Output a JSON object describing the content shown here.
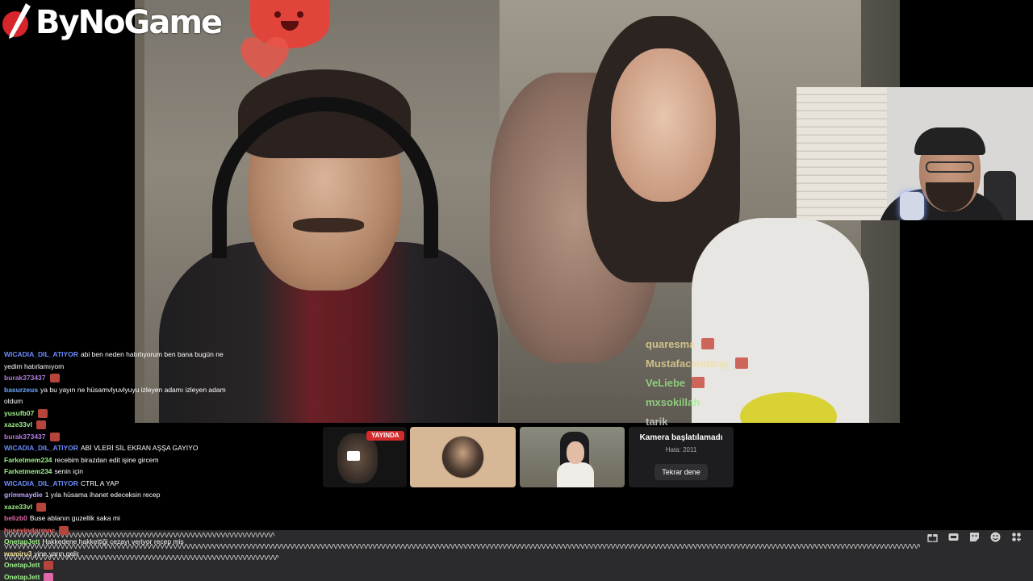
{
  "brand": {
    "logo_text": "ByNoGame"
  },
  "overlay_chat": [
    {
      "user": "quaresma",
      "color": "#f0e09a"
    },
    {
      "user": "Mustafacandang",
      "color": "#f0e09a"
    },
    {
      "user": "VeLiebe",
      "color": "#9ef08a"
    },
    {
      "user": "mxsokillah",
      "color": "#9ef08a"
    },
    {
      "user": "tarik",
      "color": "#dddddd"
    }
  ],
  "chat": [
    {
      "user": "WICADIA_DIL_ATIYOR",
      "color": "#6b8cff",
      "text": "abi ben neden hatırlıyorum ben bana bugün ne"
    },
    {
      "user": "",
      "color": "#ffffff",
      "text": "yedim hatırlamıyom"
    },
    {
      "user": "burak373437",
      "color": "#b07ae0",
      "text": "",
      "emote": true
    },
    {
      "user": "basurzeus",
      "color": "#6fa8ff",
      "text": "ya bu yayın ne hüsamvlyuvlyuyu izleyen adamı izleyen adam oldum"
    },
    {
      "user": "yusufb07",
      "color": "#9ef08a",
      "text": "",
      "emote": true
    },
    {
      "user": "xaze33vl",
      "color": "#9ef08a",
      "text": "",
      "emote": true
    },
    {
      "user": "burak373437",
      "color": "#b07ae0",
      "text": "",
      "emote": true
    },
    {
      "user": "WICADIA_DIL_ATIYOR",
      "color": "#6b8cff",
      "text": "ABİ VLERİ SİL EKRAN AŞŞA GAYIYO"
    },
    {
      "user": "Farketmem234",
      "color": "#9ef08a",
      "text": "recebim birazdan edit işine gircem"
    },
    {
      "user": "Farketmem234",
      "color": "#9ef08a",
      "text": "senin için"
    },
    {
      "user": "WICADIA_DIL_ATIYOR",
      "color": "#6b8cff",
      "text": "CTRL A YAP"
    },
    {
      "user": "grimmaydie",
      "color": "#c0a8ff",
      "text": "1 yıla hüsama ihanet edeceksin recep"
    },
    {
      "user": "xaze33vl",
      "color": "#9ef08a",
      "text": "",
      "emote": true
    },
    {
      "user": "belizb0",
      "color": "#e06aa8",
      "text": "Buse ablanın guzellik saka mi"
    },
    {
      "user": "huseyindgrmnc",
      "color": "#ff6a6a",
      "text": "",
      "emote": true
    },
    {
      "user": "OnetapJett",
      "color": "#9ef08a",
      "text": "Hakkedene hakkettiği cezayı veriyor recep mis"
    },
    {
      "user": "wamiru3",
      "color": "#f0e09a",
      "text": "yine yarın gelir"
    },
    {
      "user": "OnetapJett",
      "color": "#9ef08a",
      "text": "",
      "emote": true
    },
    {
      "user": "OnetapJett",
      "color": "#9ef08a",
      "text": "",
      "emote": true,
      "emote_pink": true
    }
  ],
  "spam_lines": [
    "VVVVVVVVVVVVVVVVVVVVVVVVVVVVVVVVVVVVVVVVVVVVVVVVVVVVVVVVVVVVVVVVVVVVVVVV--",
    "VVVVVVVVVVVVVVVVVVVVVVVVVVVVVVVVVVVVVVVVVVVVVVVVVVVVVVVVVVVVVVVVVVVVVVVVVVVVVVVVVVVVVVVVVVVVVVVVVVVVVVVVVVVVVVVVVVVVVVVVVVVVVVVVVVVVVVVVVVVVVVVVVVVVVVVVVVVVVVVVVVVVVVVVVVVVVVVVVVVVVVVVVVVVVVVVVVVVVVVVVVVVVVVVVVVVVVVVVVVVVVVVVVVVVVVVVVVVVVVVVVVVVVVVVV",
    "VVVVVVVVVVVVVVVVVVVVVVVVVVVVVVVVVVVVVVVVVVVVVVVVVVVVVVVVVVVVVVVVVVVVVVVVVV"
  ],
  "participants": {
    "live_label": "YAYINDA",
    "camera_error": {
      "title": "Kamera başlatılamadı",
      "subtitle": "Hata: 2011",
      "retry": "Tekrar dene"
    }
  },
  "icons": [
    "gift-icon",
    "gif-icon",
    "sticker-icon",
    "emoji-icon",
    "apps-icon"
  ]
}
